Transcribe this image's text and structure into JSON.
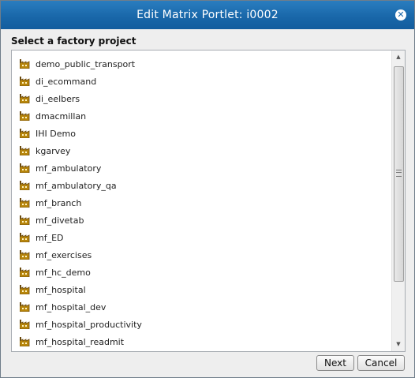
{
  "dialog": {
    "title": "Edit Matrix Portlet: i0002",
    "close_icon": "close-icon",
    "heading": "Select a factory project"
  },
  "projects": {
    "icon": "factory-icon",
    "items": [
      "demo_public_transport",
      "di_ecommand",
      "di_eelbers",
      "dmacmillan",
      "IHI Demo",
      "kgarvey",
      "mf_ambulatory",
      "mf_ambulatory_qa",
      "mf_branch",
      "mf_divetab",
      "mf_ED",
      "mf_exercises",
      "mf_hc_demo",
      "mf_hospital",
      "mf_hospital_dev",
      "mf_hospital_productivity",
      "mf_hospital_readmit"
    ]
  },
  "buttons": {
    "next": "Next",
    "cancel": "Cancel"
  },
  "colors": {
    "titlebar": "#1866a8",
    "dialog_bg": "#eeeeee",
    "icon": "#b8860b"
  }
}
